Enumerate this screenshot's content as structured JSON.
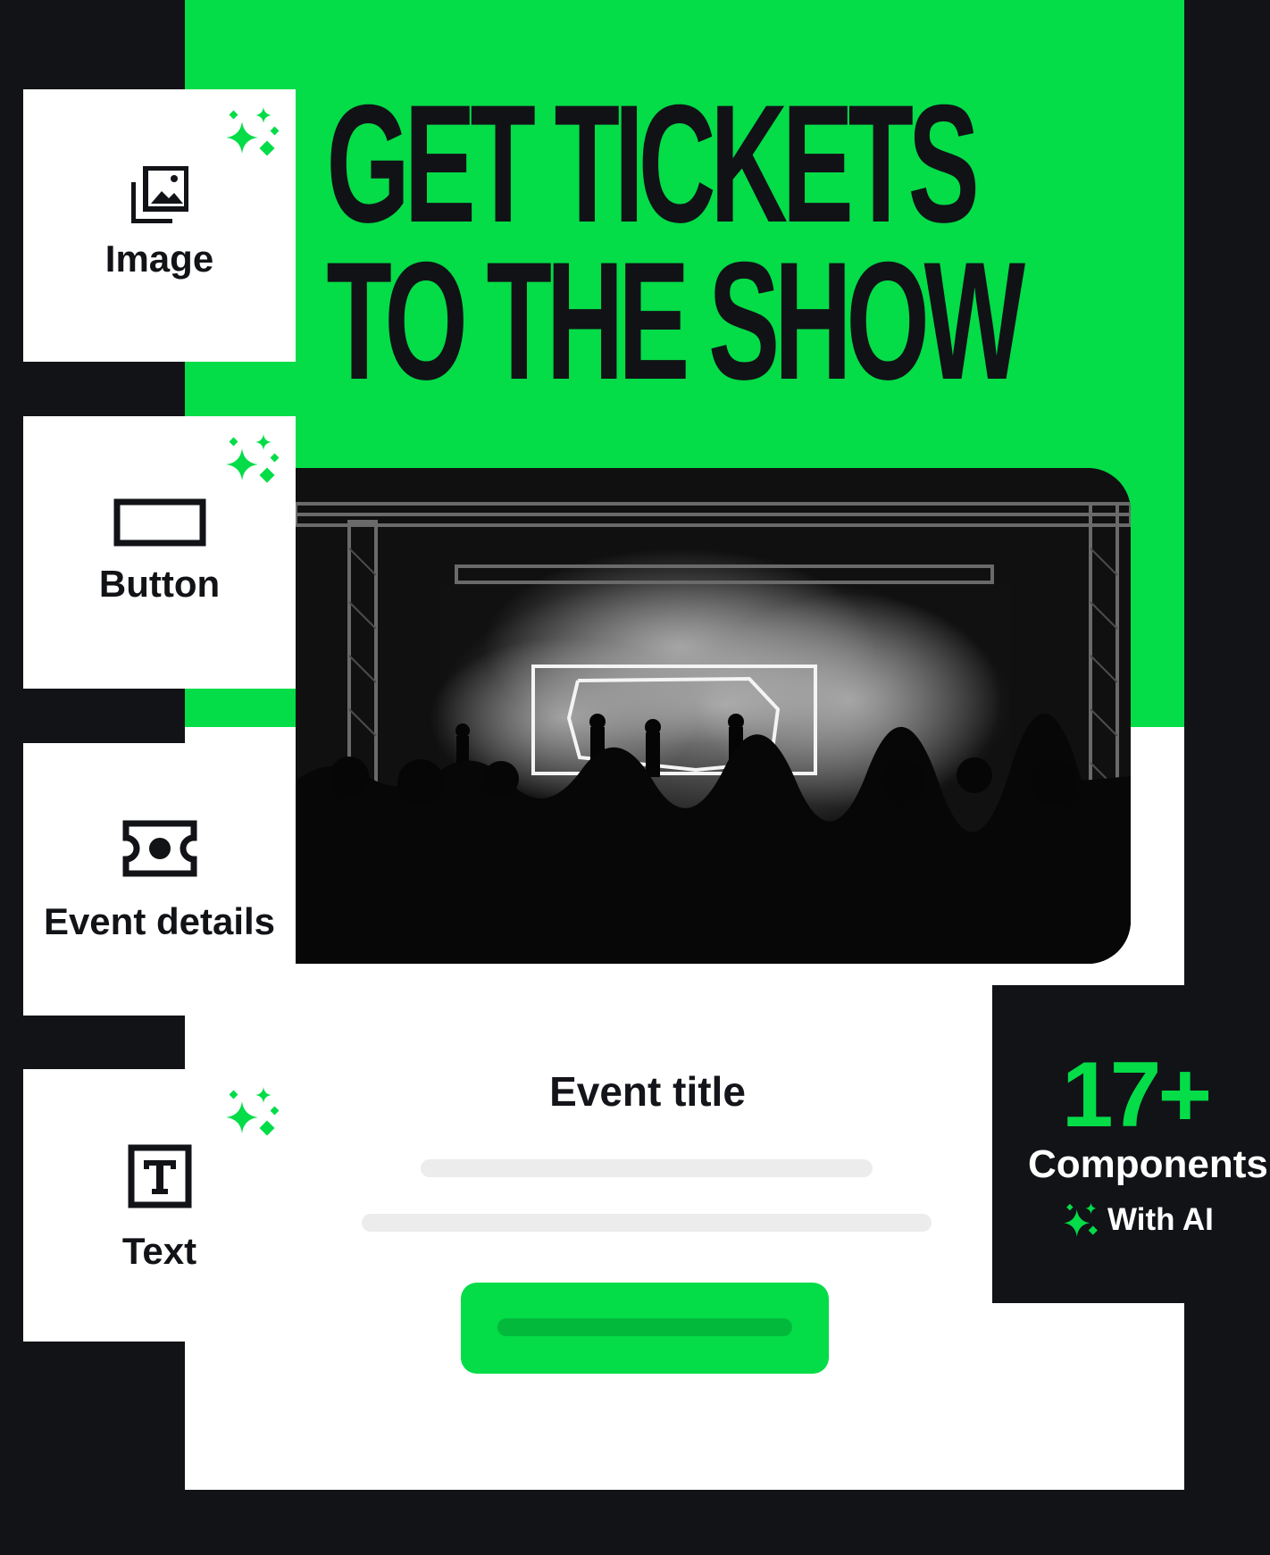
{
  "headline": {
    "line1": "GET TICKETS",
    "line2": "TO THE SHOW"
  },
  "components": [
    {
      "label": "Image",
      "icon": "image-gallery-icon",
      "ai": true
    },
    {
      "label": "Button",
      "icon": "button-outline-icon",
      "ai": true
    },
    {
      "label": "Event details",
      "icon": "ticket-icon",
      "ai": false
    },
    {
      "label": "Text",
      "icon": "text-box-icon",
      "ai": true
    }
  ],
  "event": {
    "title": "Event title",
    "image": "concert-stage-photo"
  },
  "badge": {
    "count": "17+",
    "label": "Components",
    "ai_label": "With AI",
    "icon": "sparkle-icon"
  },
  "colors": {
    "accent": "#04dc48",
    "dark": "#121317",
    "placeholder": "#ececec",
    "white": "#ffffff"
  }
}
